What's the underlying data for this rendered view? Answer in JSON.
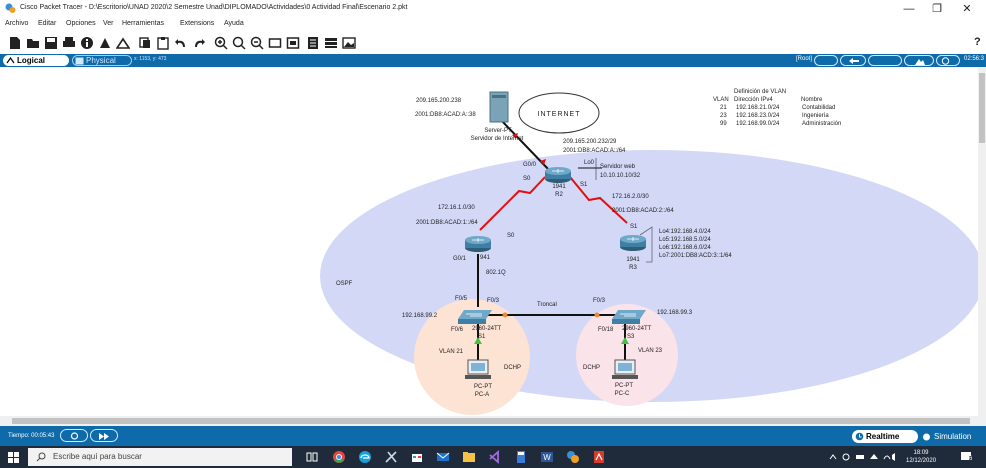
{
  "window": {
    "title": "Cisco Packet Tracer - D:\\Escritorio\\UNAD 2020\\2 Semestre Unad\\DIPLOMADO\\Actividades\\0 Actividad Final\\Escenario 2.pkt",
    "minimize": "—",
    "restore": "❐",
    "close": "✕"
  },
  "menu": [
    "Archivo",
    "Editar",
    "Opciones",
    "Ver",
    "Herramientas",
    "Extensions",
    "Ayuda"
  ],
  "toolbar": {
    "help": "?"
  },
  "modebar": {
    "logical": "Logical",
    "physical": "Physical",
    "coords": "x: 1153, y: 473",
    "root": "[Root]",
    "clock": "02:56:3"
  },
  "topology": {
    "server": {
      "ip4": "209.165.200.238",
      "ip6": "2001:DB8:ACAD:A::38",
      "name1": "Server-PT",
      "name2": "Servidor de Internet"
    },
    "internet": "INTERNET",
    "r2": {
      "net4": "209.165.200.232/29",
      "net6": "2001:DB8:ACAD:A::/64",
      "g00": "G0/0",
      "s0": "S0",
      "s1": "S1",
      "lo0": "Lo0",
      "web1": "Servidor web",
      "web2": "10.10.10.10/32",
      "model": "1941",
      "name": "R2"
    },
    "link13": {
      "net4": "172.16.1.0/30",
      "net6": "2001:DB8:ACAD:1::/64",
      "s0": "S0"
    },
    "link23": {
      "net4": "172.16.2.0/30",
      "net6": "2001:DB8:ACAD:2::/64",
      "s1": "S1"
    },
    "r3": {
      "model": "1941",
      "name": "R3",
      "loopbacks": [
        "Lo4:192.168.4.0/24",
        "Lo5:192.168.5.0/24",
        "Lo6:192.168.6.0/24",
        "Lo7:2001:DB8:ACD:3::1/64"
      ]
    },
    "r1": {
      "g01": "G0/1",
      "model": "941",
      "dot1q": "802.1Q"
    },
    "ospf": "OSPF",
    "s1sw": {
      "ip": "192.168.99.2",
      "f05": "F0/5",
      "f03": "F0/3",
      "f06": "F0/6",
      "model": "2960-24TT",
      "name": "S1"
    },
    "s3sw": {
      "ip": "192.168.99.3",
      "f03": "F0/3",
      "f018": "F0/18",
      "model": "2960-24TT",
      "name": "S3"
    },
    "troncal": "Troncal",
    "vlan21": "VLAN 21",
    "vlan23": "VLAN 23",
    "dhcp_a": "DCHP",
    "dhcp_c": "DCHP",
    "pca": {
      "type": "PC-PT",
      "name": "PC-A"
    },
    "pcc": {
      "type": "PC-PT",
      "name": "PC-C"
    },
    "vlan_table": {
      "title": "Definición de VLAN",
      "headers": [
        "VLAN",
        "Dirección IPv4",
        "Nombre"
      ],
      "rows": [
        [
          "21",
          "192.168.21.0/24",
          "Contabilidad"
        ],
        [
          "23",
          "192.168.23.0/24",
          "Ingeniería"
        ],
        [
          "99",
          "192.168.99.0/24",
          "Administración"
        ]
      ]
    }
  },
  "bottombar": {
    "timer": "Tiempo: 00:05:43",
    "realtime": "Realtime",
    "simulation": "Simulation"
  },
  "taskbar": {
    "search": "Escribe aquí para buscar",
    "time": "18:09",
    "date": "12/12/2020",
    "notifications": "6"
  },
  "colors": {
    "accent": "#0e6aa8",
    "ospf_area": "#d3d8f7",
    "vlan21_area": "#fce3d4",
    "vlan23_area": "#fbe3ea",
    "serial_link": "#e01010",
    "lan_link": "#111111"
  }
}
